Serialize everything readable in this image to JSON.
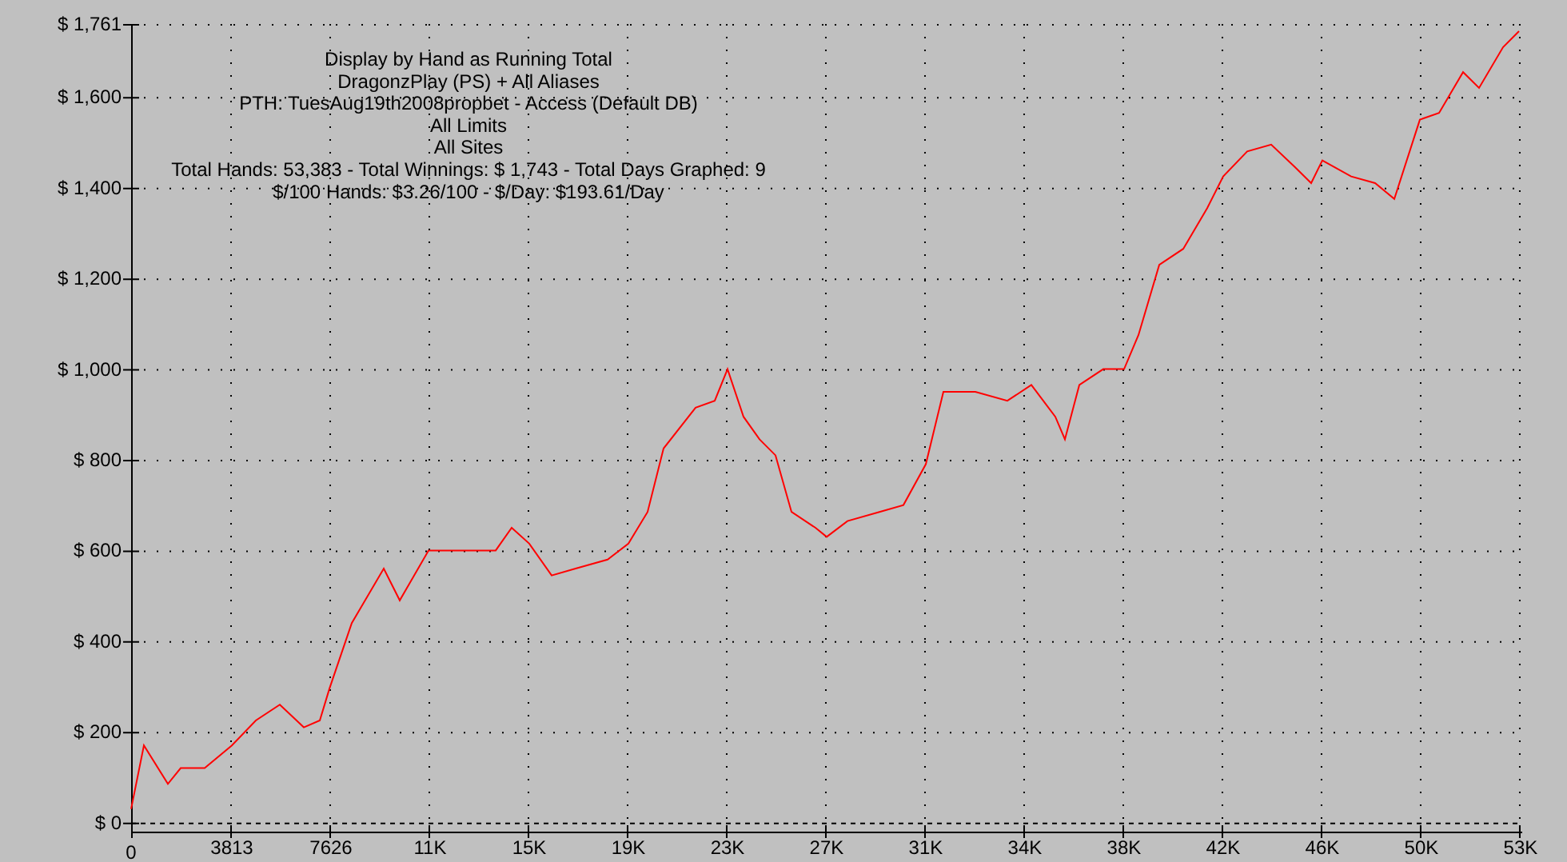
{
  "chart": {
    "subtitle_lines": [
      "DragonzPlay (PS) + All Aliases",
      "PTH: TuesAug19th2008propbet - Access (Default DB)",
      "All Limits",
      "All Sites",
      "Total Hands: 53,383 - Total Winnings: $ 1,743 - Total Days Graphed: 9",
      "$/100 Hands: $3.26/100 - $/Day: $193.61/Day"
    ],
    "chart_data": {
      "type": "line",
      "title": "Display by Hand as Running Total",
      "x": [
        0,
        492,
        1415,
        1907,
        2829,
        3875,
        4797,
        5720,
        6642,
        7257,
        7626,
        8487,
        9717,
        10332,
        11439,
        12792,
        14022,
        14637,
        15314,
        16175,
        17097,
        18327,
        19127,
        19865,
        20480,
        21710,
        22448,
        22940,
        23555,
        24170,
        24785,
        25400,
        26322,
        26753,
        27552,
        28782,
        29705,
        30566,
        31242,
        32472,
        33702,
        34625,
        35547,
        35916,
        36470,
        37392,
        38192,
        38745,
        39545,
        40467,
        41390,
        42005,
        42927,
        43850,
        44772,
        45387,
        45817,
        46925,
        47847,
        48585,
        49569,
        50307,
        51230,
        51845,
        52767,
        53382
      ],
      "series": [
        {
          "color": "#ff0000",
          "values": [
            30,
            170,
            85,
            120,
            120,
            170,
            225,
            260,
            210,
            225,
            295,
            440,
            560,
            490,
            600,
            600,
            600,
            650,
            615,
            545,
            560,
            580,
            615,
            685,
            825,
            915,
            930,
            1000,
            895,
            845,
            810,
            685,
            650,
            630,
            665,
            685,
            700,
            790,
            950,
            950,
            930,
            965,
            895,
            845,
            965,
            1000,
            1000,
            1075,
            1230,
            1265,
            1355,
            1425,
            1480,
            1495,
            1445,
            1410,
            1460,
            1425,
            1410,
            1375,
            1550,
            1565,
            1655,
            1620,
            1710,
            1745
          ]
        }
      ],
      "grid": true,
      "xlim": [
        0,
        53383
      ],
      "ylim": [
        -20,
        1761
      ],
      "xticks": [
        {
          "value": 0,
          "label": "0"
        },
        {
          "value": 3813,
          "label": "3813"
        },
        {
          "value": 7626,
          "label": "7626"
        },
        {
          "value": 11439,
          "label": "11K"
        },
        {
          "value": 15252,
          "label": "15K"
        },
        {
          "value": 19065,
          "label": "19K"
        },
        {
          "value": 22878,
          "label": "23K"
        },
        {
          "value": 26691,
          "label": "27K"
        },
        {
          "value": 30504,
          "label": "31K"
        },
        {
          "value": 34317,
          "label": "34K"
        },
        {
          "value": 38130,
          "label": "38K"
        },
        {
          "value": 41943,
          "label": "42K"
        },
        {
          "value": 45756,
          "label": "46K"
        },
        {
          "value": 49569,
          "label": "50K"
        },
        {
          "value": 53382,
          "label": "53K"
        }
      ],
      "yticks": [
        {
          "value": 0,
          "label": "$ 0"
        },
        {
          "value": 200,
          "label": "$ 200"
        },
        {
          "value": 400,
          "label": "$ 400"
        },
        {
          "value": 600,
          "label": "$ 600"
        },
        {
          "value": 800,
          "label": "$ 800"
        },
        {
          "value": 1000,
          "label": "$ 1,000"
        },
        {
          "value": 1200,
          "label": "$ 1,200"
        },
        {
          "value": 1400,
          "label": "$ 1,400"
        },
        {
          "value": 1600,
          "label": "$ 1,600"
        },
        {
          "value": 1761,
          "label": "$ 1,761"
        }
      ]
    }
  }
}
